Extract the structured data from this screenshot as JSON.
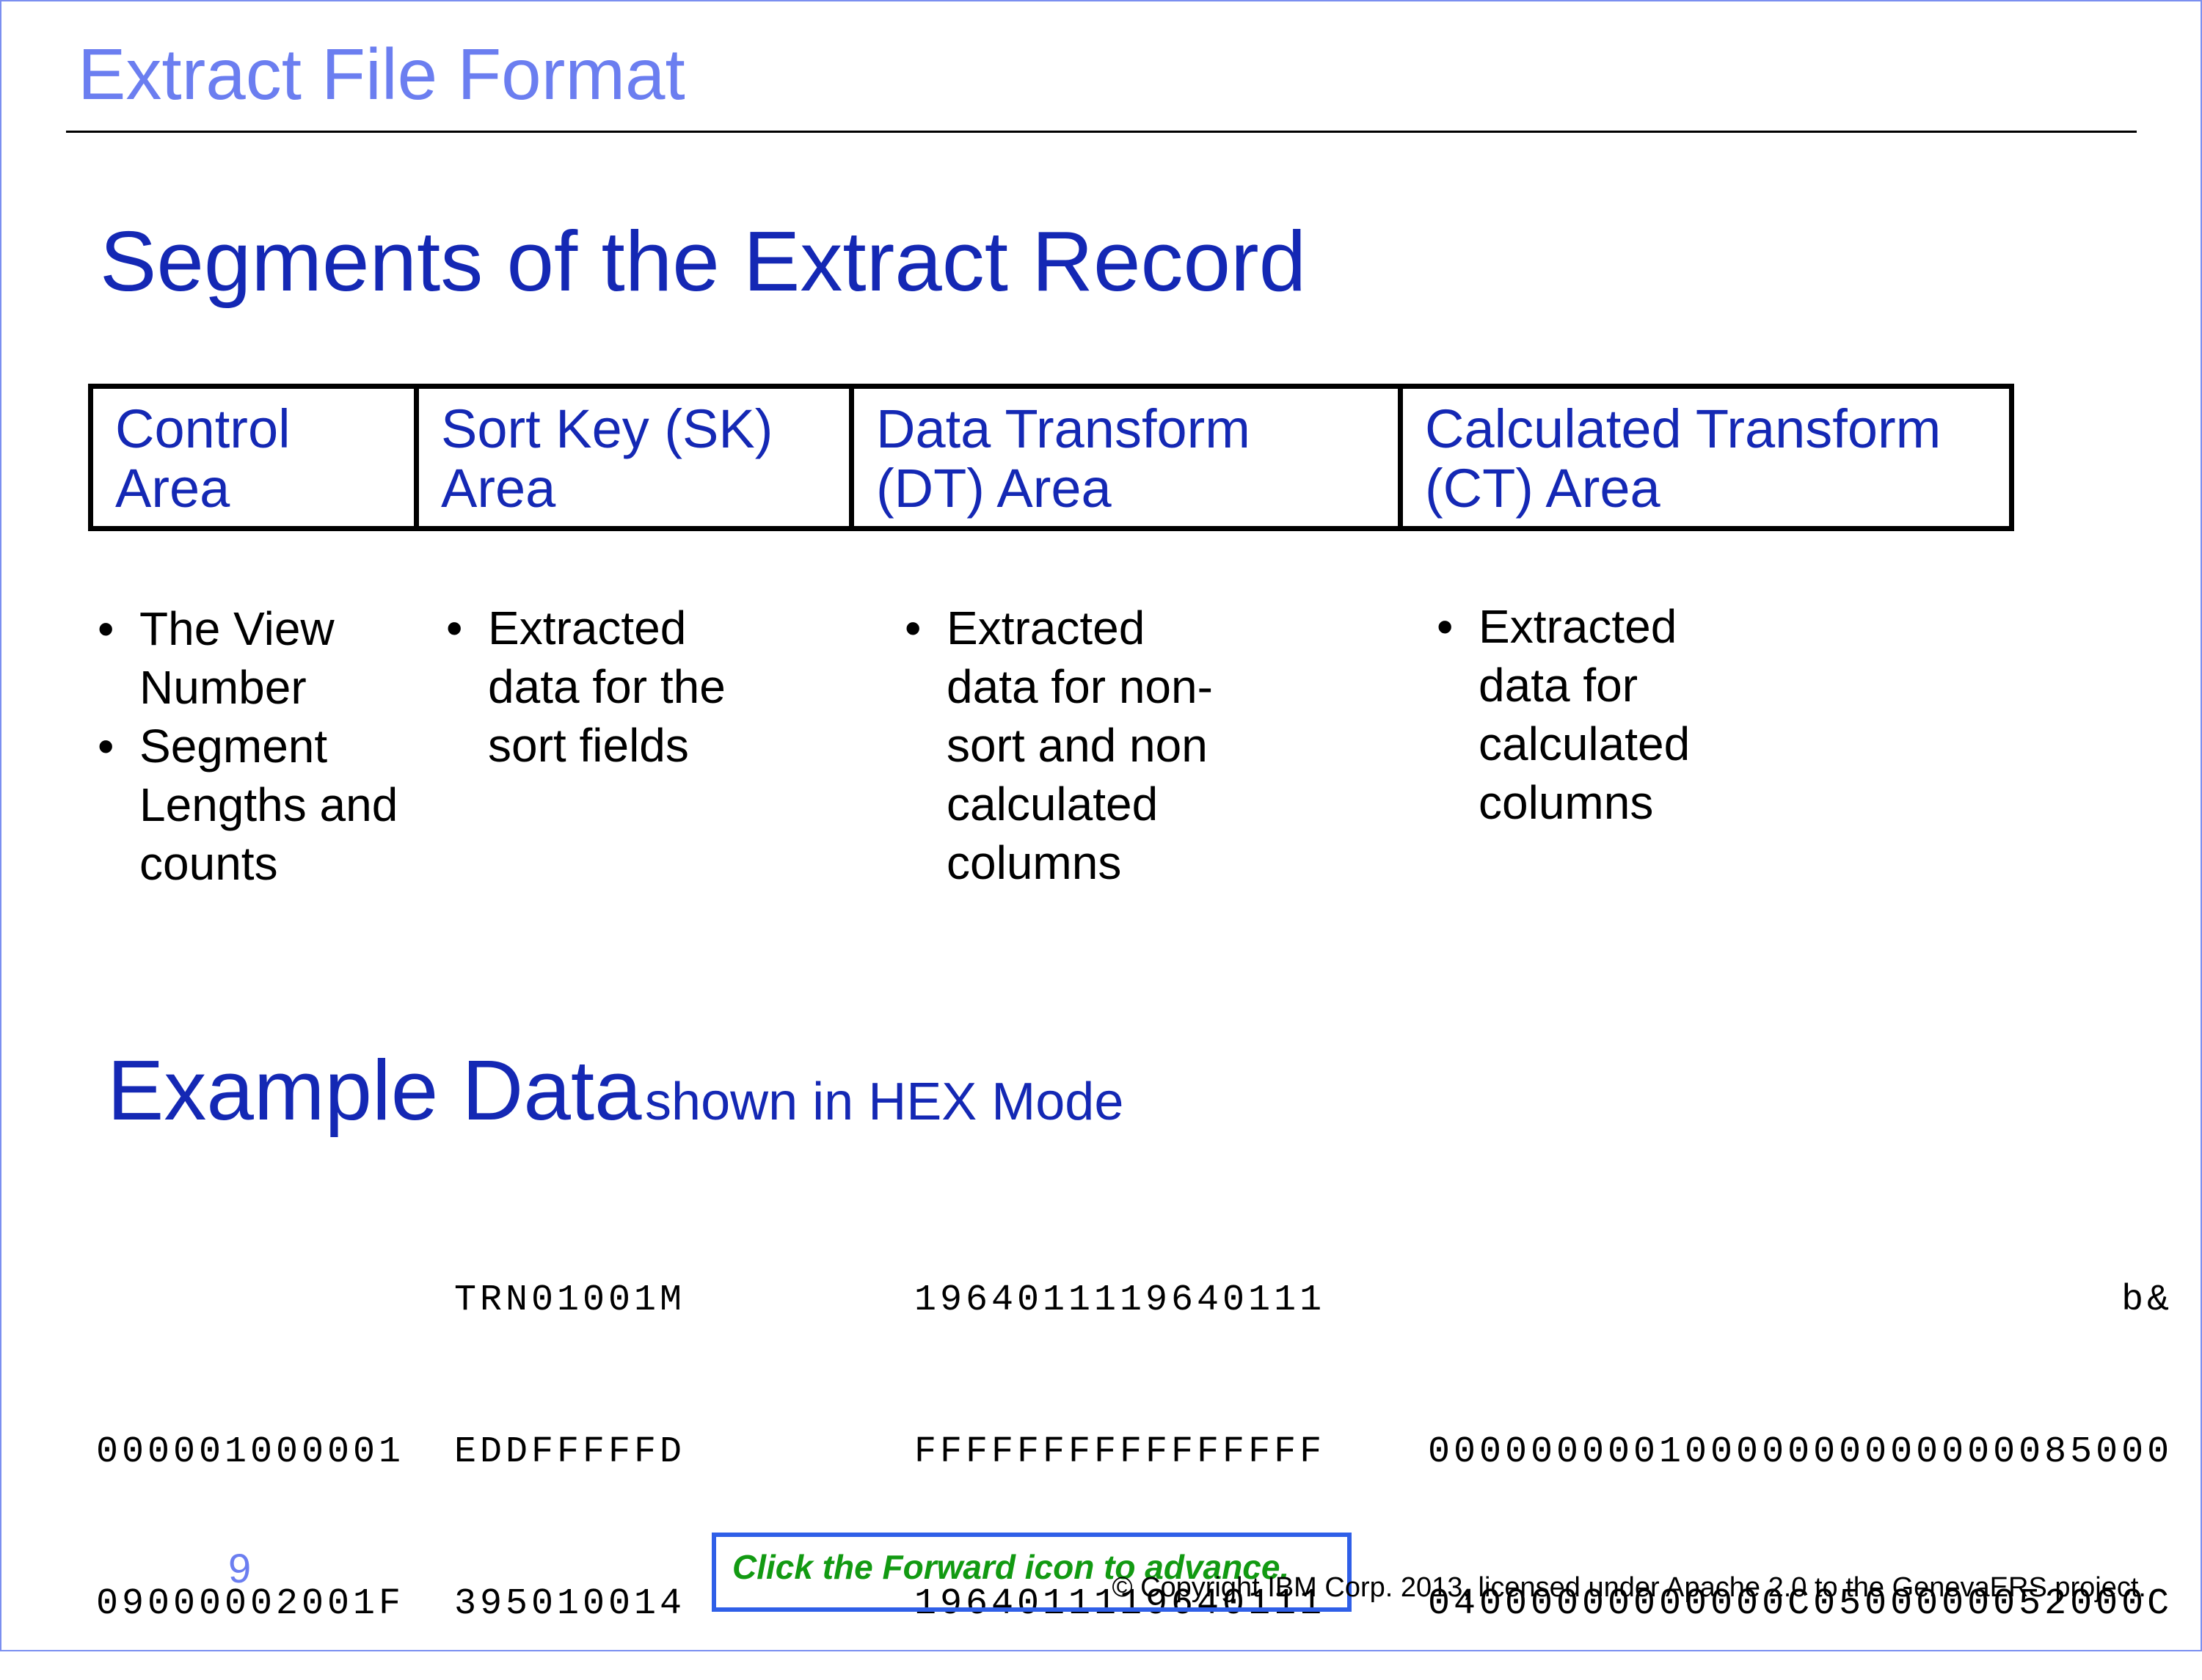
{
  "header": {
    "title": "Extract File Format"
  },
  "section": {
    "title": "Segments of the Extract Record"
  },
  "segments": [
    {
      "line1": "Control",
      "line2": "Area"
    },
    {
      "line1": "Sort Key (SK)",
      "line2": "Area"
    },
    {
      "line1": "Data Transform",
      "line2": "(DT)  Area"
    },
    {
      "line1": "Calculated Transform",
      "line2": "(CT) Area"
    }
  ],
  "bullets": {
    "control": [
      [
        "The View",
        "Number"
      ],
      [
        "Segment",
        "Lengths and",
        "counts"
      ]
    ],
    "sort_key": [
      [
        "Extracted",
        "data for the",
        "sort fields"
      ]
    ],
    "data_transform": [
      [
        "Extracted",
        "data for non-",
        "sort and non",
        "calculated",
        "columns"
      ]
    ],
    "calculated": [
      [
        "Extracted",
        "data for",
        "calculated",
        "columns"
      ]
    ]
  },
  "example": {
    "title": "Example Data",
    "subtitle": "shown in HEX Mode"
  },
  "hex": {
    "control": [
      "",
      "000001000001",
      "09000002001F"
    ],
    "sort_key": [
      "TRN01001M",
      "EDDFFFFFD",
      "395010014"
    ],
    "data_transform": [
      "1964011119640111",
      "FFFFFFFFFFFFFFFF",
      "1964011119640111"
    ],
    "calculated": [
      "b&",
      "00000000010000000000000085000",
      "04000000000000C0500000052000C"
    ]
  },
  "footer": {
    "page_number": "9",
    "advance_text": "Click the Forward icon to advance.",
    "copyright": "© Copyright IBM Corp. 2013, licensed under Apache 2.0 to the GenevaERS project."
  }
}
